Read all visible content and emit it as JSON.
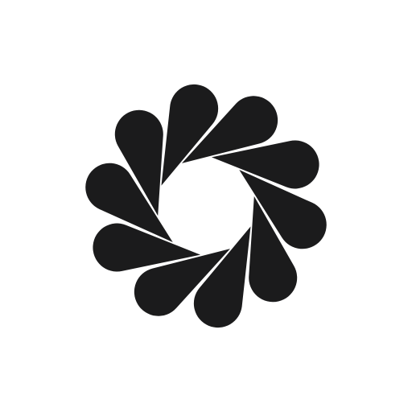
{
  "logo": {
    "icon": "pinwheel-petals-icon",
    "petal_count": 10,
    "color": "#1b1b1c",
    "background": "#ffffff"
  }
}
